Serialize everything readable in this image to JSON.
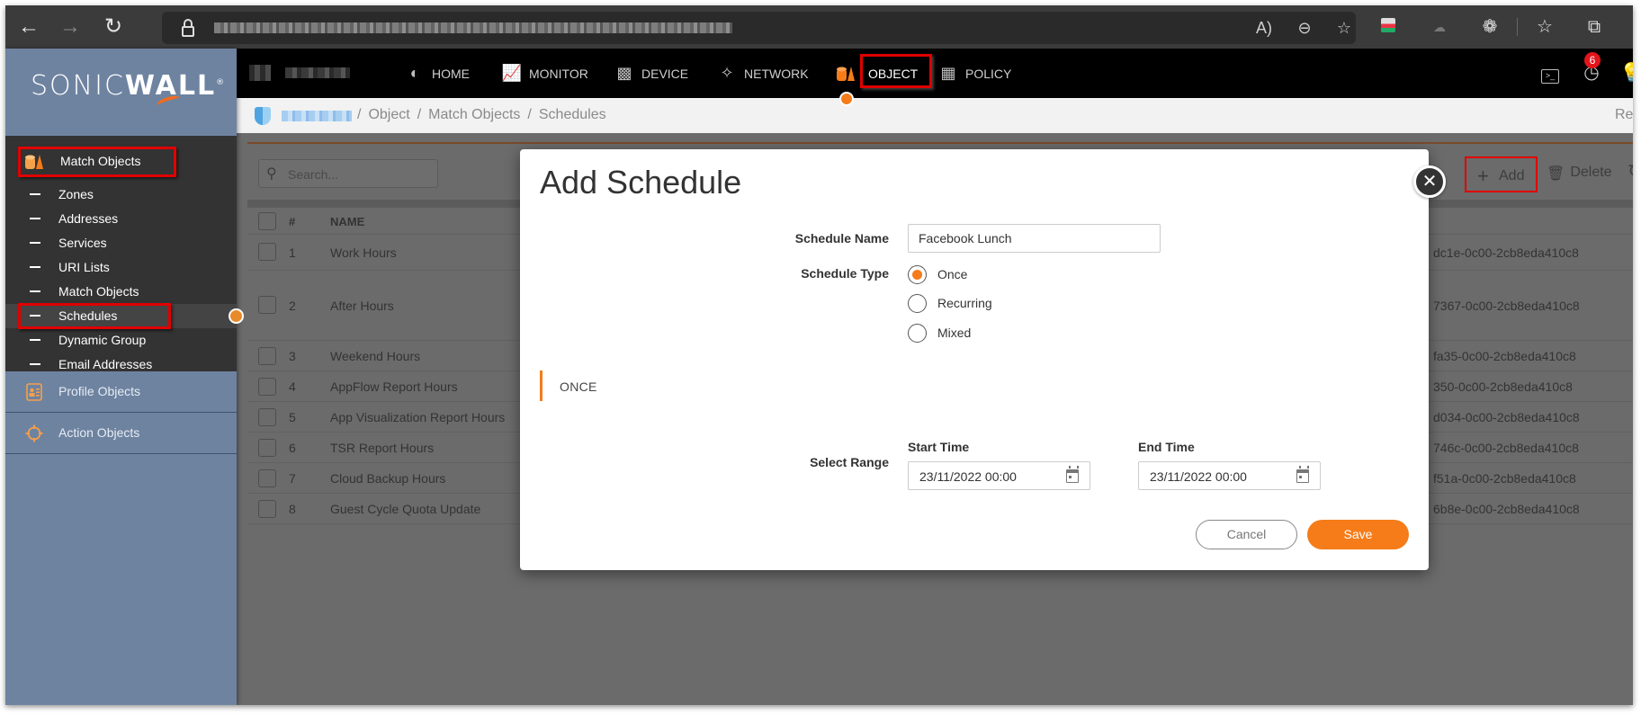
{
  "browser": {
    "back_icon": "arrow-left-icon",
    "forward_icon": "arrow-right-icon",
    "refresh_icon": "refresh-icon",
    "lock_icon": "lock-icon",
    "address_icons": [
      "read-aloud-icon",
      "zoom-out-icon",
      "add-favorite-icon"
    ],
    "extension_icons": [
      "chrome-extension-icon",
      "five9-extension-icon",
      "extensions-puzzle-icon",
      "favorites-icon",
      "collections-icon"
    ]
  },
  "brand": {
    "logo_light": "SONIC",
    "logo_bold": "WALL",
    "logo_mark": "®",
    "accent_color": "#f57c19",
    "highlight_color": "#e00000"
  },
  "sidebar": {
    "group": {
      "label": "Match Objects",
      "icon": "match-objects-icon"
    },
    "items": [
      {
        "label": "Zones"
      },
      {
        "label": "Addresses"
      },
      {
        "label": "Services"
      },
      {
        "label": "URI Lists"
      },
      {
        "label": "Match Objects"
      },
      {
        "label": "Schedules",
        "active": true
      },
      {
        "label": "Dynamic Group"
      },
      {
        "label": "Email Addresses"
      }
    ],
    "sections": [
      {
        "label": "Profile Objects",
        "icon": "profile-objects-icon"
      },
      {
        "label": "Action Objects",
        "icon": "action-objects-icon"
      }
    ]
  },
  "topnav": {
    "items": [
      {
        "label": "HOME",
        "icon": "dashboard-gauge-icon"
      },
      {
        "label": "MONITOR",
        "icon": "monitor-chart-icon"
      },
      {
        "label": "DEVICE",
        "icon": "device-monitor-icon"
      },
      {
        "label": "NETWORK",
        "icon": "network-nodes-icon"
      },
      {
        "label": "OBJECT",
        "icon": "object-icon",
        "active": true
      },
      {
        "label": "POLICY",
        "icon": "policy-firewall-icon"
      }
    ],
    "right_icons": [
      "terminal-icon",
      "alarm-clock-icon",
      "lightbulb-icon"
    ],
    "notification_count": "6"
  },
  "breadcrumb": {
    "items": [
      "Object",
      "Match Objects",
      "Schedules"
    ],
    "separator": "/",
    "right_text": "Re"
  },
  "toolbar": {
    "search_placeholder": "Search...",
    "add_label": "Add",
    "delete_label": "Delete"
  },
  "table": {
    "columns": [
      "#",
      "NAME"
    ],
    "rows": [
      {
        "num": "1",
        "name": "Work Hours",
        "uuid_tail": "dc1e-0c00-2cb8eda410c8"
      },
      {
        "num": "2",
        "name": "After Hours",
        "uuid_tail": "7367-0c00-2cb8eda410c8"
      },
      {
        "num": "3",
        "name": "Weekend Hours",
        "uuid_tail": "fa35-0c00-2cb8eda410c8"
      },
      {
        "num": "4",
        "name": "AppFlow Report Hours",
        "uuid_tail": "350-0c00-2cb8eda410c8"
      },
      {
        "num": "5",
        "name": "App Visualization Report Hours",
        "uuid_tail": "d034-0c00-2cb8eda410c8"
      },
      {
        "num": "6",
        "name": "TSR Report Hours",
        "uuid_tail": "746c-0c00-2cb8eda410c8"
      },
      {
        "num": "7",
        "name": "Cloud Backup Hours",
        "uuid_tail": "f51a-0c00-2cb8eda410c8"
      },
      {
        "num": "8",
        "name": "Guest Cycle Quota Update",
        "uuid_tail": "6b8e-0c00-2cb8eda410c8"
      }
    ]
  },
  "modal": {
    "title": "Add Schedule",
    "close_icon": "close-icon",
    "schedule_name_label": "Schedule Name",
    "schedule_name_value": "Facebook Lunch",
    "schedule_type_label": "Schedule Type",
    "schedule_types": [
      {
        "label": "Once",
        "checked": true
      },
      {
        "label": "Recurring",
        "checked": false
      },
      {
        "label": "Mixed",
        "checked": false
      }
    ],
    "section_label": "ONCE",
    "select_range_label": "Select Range",
    "start_time_label": "Start Time",
    "start_time_value": "23/11/2022 00:00",
    "end_time_label": "End Time",
    "end_time_value": "23/11/2022 00:00",
    "cancel_label": "Cancel",
    "save_label": "Save"
  }
}
